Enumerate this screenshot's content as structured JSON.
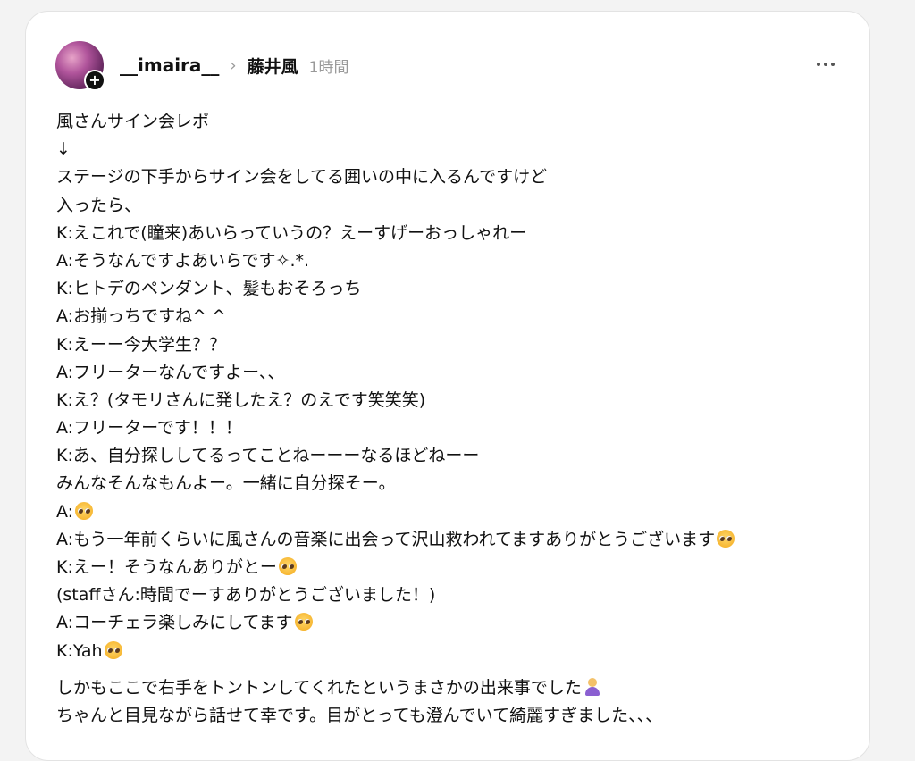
{
  "post": {
    "user": {
      "username": "__imaira__",
      "avatar_icon": "user-avatar"
    },
    "follow_icon": "+",
    "community": "藤井風",
    "time_ago": "1時間",
    "more_icon": "ellipsis-icon",
    "lines": [
      "風さんサイン会レポ",
      "↓",
      "ステージの下手からサイン会をしてる囲いの中に入るんですけど",
      "入ったら、",
      "K:えこれで(瞳来)あいらっていうの？えーすげーおっしゃれー",
      "A:そうなんですよあいらです✧.*.",
      "K:ヒトデのペンダント、髪もおそろっち",
      "A:お揃っちですね^ ^",
      "K:えーー今大学生？？",
      "A:フリーターなんですよー、、",
      "K:え？(タモリさんに発したえ？のえです笑笑笑)",
      "A:フリーターです！！！",
      "K:あ、自分探ししてるってことねーーーなるほどねーー",
      "みんなそんなもんよー。一緒に自分探そー。",
      "A:",
      "A:もう一年前くらいに風さんの音楽に出会って沢山救われてますありがとうございます",
      "K:えー！そうなんありがとー",
      "(staffさん:時間でーすありがとうございました！)",
      "A:コーチェラ楽しみにしてます",
      "K:Yah",
      "しかもここで右手をトントンしてくれたというまさかの出来事でした",
      "ちゃんと目見ながら話せて幸です。目がとっても澄んでいて綺麗すぎました、、、"
    ]
  }
}
